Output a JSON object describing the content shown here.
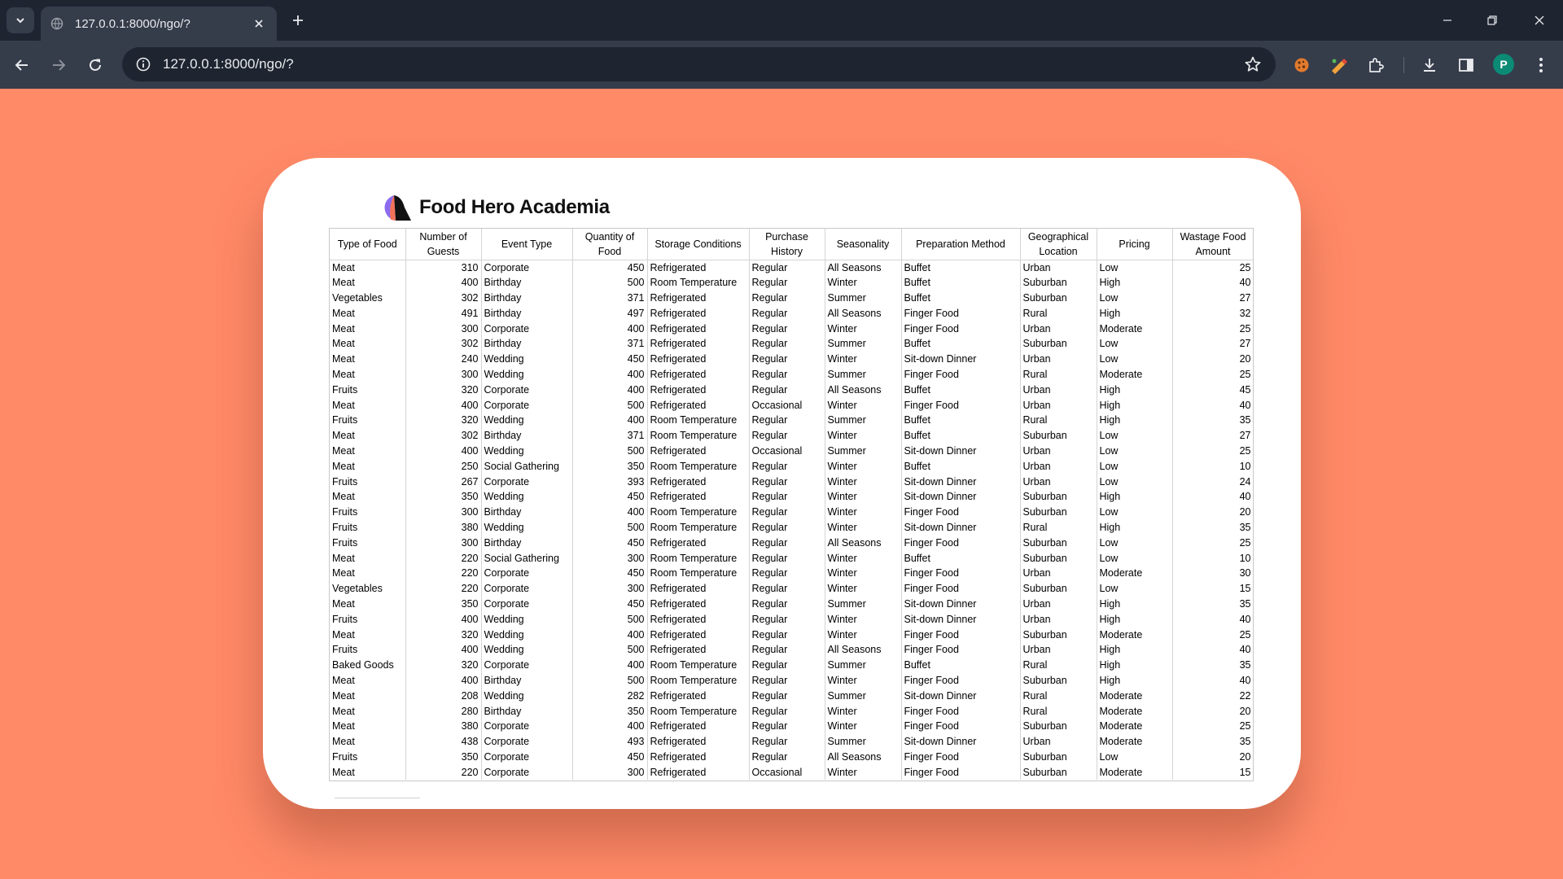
{
  "browser": {
    "tab_title": "127.0.0.1:8000/ngo/?",
    "url": "127.0.0.1:8000/ngo/?",
    "profile_initial": "P"
  },
  "page": {
    "brand_name": "Food Hero Academia",
    "colors": {
      "background": "#ff8a68",
      "card": "#ffffff"
    }
  },
  "table": {
    "headers": [
      "Type of Food",
      "Number of Guests",
      "Event Type",
      "Quantity of Food",
      "Storage Conditions",
      "Purchase History",
      "Seasonality",
      "Preparation Method",
      "Geographical Location",
      "Pricing",
      "Wastage Food Amount"
    ],
    "rows": [
      [
        "Meat",
        "310",
        "Corporate",
        "450",
        "Refrigerated",
        "Regular",
        "All Seasons",
        "Buffet",
        "Urban",
        "Low",
        "25"
      ],
      [
        "Meat",
        "400",
        "Birthday",
        "500",
        "Room Temperature",
        "Regular",
        "Winter",
        "Buffet",
        "Suburban",
        "High",
        "40"
      ],
      [
        "Vegetables",
        "302",
        "Birthday",
        "371",
        "Refrigerated",
        "Regular",
        "Summer",
        "Buffet",
        "Suburban",
        "Low",
        "27"
      ],
      [
        "Meat",
        "491",
        "Birthday",
        "497",
        "Refrigerated",
        "Regular",
        "All Seasons",
        "Finger Food",
        "Rural",
        "High",
        "32"
      ],
      [
        "Meat",
        "300",
        "Corporate",
        "400",
        "Refrigerated",
        "Regular",
        "Winter",
        "Finger Food",
        "Urban",
        "Moderate",
        "25"
      ],
      [
        "Meat",
        "302",
        "Birthday",
        "371",
        "Refrigerated",
        "Regular",
        "Summer",
        "Buffet",
        "Suburban",
        "Low",
        "27"
      ],
      [
        "Meat",
        "240",
        "Wedding",
        "450",
        "Refrigerated",
        "Regular",
        "Winter",
        "Sit-down Dinner",
        "Urban",
        "Low",
        "20"
      ],
      [
        "Meat",
        "300",
        "Wedding",
        "400",
        "Refrigerated",
        "Regular",
        "Summer",
        "Finger Food",
        "Rural",
        "Moderate",
        "25"
      ],
      [
        "Fruits",
        "320",
        "Corporate",
        "400",
        "Refrigerated",
        "Regular",
        "All Seasons",
        "Buffet",
        "Urban",
        "High",
        "45"
      ],
      [
        "Meat",
        "400",
        "Corporate",
        "500",
        "Refrigerated",
        "Occasional",
        "Winter",
        "Finger Food",
        "Urban",
        "High",
        "40"
      ],
      [
        "Fruits",
        "320",
        "Wedding",
        "400",
        "Room Temperature",
        "Regular",
        "Summer",
        "Buffet",
        "Rural",
        "High",
        "35"
      ],
      [
        "Meat",
        "302",
        "Birthday",
        "371",
        "Room Temperature",
        "Regular",
        "Winter",
        "Buffet",
        "Suburban",
        "Low",
        "27"
      ],
      [
        "Meat",
        "400",
        "Wedding",
        "500",
        "Refrigerated",
        "Occasional",
        "Summer",
        "Sit-down Dinner",
        "Urban",
        "Low",
        "25"
      ],
      [
        "Meat",
        "250",
        "Social Gathering",
        "350",
        "Room Temperature",
        "Regular",
        "Winter",
        "Buffet",
        "Urban",
        "Low",
        "10"
      ],
      [
        "Fruits",
        "267",
        "Corporate",
        "393",
        "Refrigerated",
        "Regular",
        "Winter",
        "Sit-down Dinner",
        "Urban",
        "Low",
        "24"
      ],
      [
        "Meat",
        "350",
        "Wedding",
        "450",
        "Refrigerated",
        "Regular",
        "Winter",
        "Sit-down Dinner",
        "Suburban",
        "High",
        "40"
      ],
      [
        "Fruits",
        "300",
        "Birthday",
        "400",
        "Room Temperature",
        "Regular",
        "Winter",
        "Finger Food",
        "Suburban",
        "Low",
        "20"
      ],
      [
        "Fruits",
        "380",
        "Wedding",
        "500",
        "Room Temperature",
        "Regular",
        "Winter",
        "Sit-down Dinner",
        "Rural",
        "High",
        "35"
      ],
      [
        "Fruits",
        "300",
        "Birthday",
        "450",
        "Refrigerated",
        "Regular",
        "All Seasons",
        "Finger Food",
        "Suburban",
        "Low",
        "25"
      ],
      [
        "Meat",
        "220",
        "Social Gathering",
        "300",
        "Room Temperature",
        "Regular",
        "Winter",
        "Buffet",
        "Suburban",
        "Low",
        "10"
      ],
      [
        "Meat",
        "220",
        "Corporate",
        "450",
        "Room Temperature",
        "Regular",
        "Winter",
        "Finger Food",
        "Urban",
        "Moderate",
        "30"
      ],
      [
        "Vegetables",
        "220",
        "Corporate",
        "300",
        "Refrigerated",
        "Regular",
        "Winter",
        "Finger Food",
        "Suburban",
        "Low",
        "15"
      ],
      [
        "Meat",
        "350",
        "Corporate",
        "450",
        "Refrigerated",
        "Regular",
        "Summer",
        "Sit-down Dinner",
        "Urban",
        "High",
        "35"
      ],
      [
        "Fruits",
        "400",
        "Wedding",
        "500",
        "Refrigerated",
        "Regular",
        "Winter",
        "Sit-down Dinner",
        "Urban",
        "High",
        "40"
      ],
      [
        "Meat",
        "320",
        "Wedding",
        "400",
        "Refrigerated",
        "Regular",
        "Winter",
        "Finger Food",
        "Suburban",
        "Moderate",
        "25"
      ],
      [
        "Fruits",
        "400",
        "Wedding",
        "500",
        "Refrigerated",
        "Regular",
        "All Seasons",
        "Finger Food",
        "Urban",
        "High",
        "40"
      ],
      [
        "Baked Goods",
        "320",
        "Corporate",
        "400",
        "Room Temperature",
        "Regular",
        "Summer",
        "Buffet",
        "Rural",
        "High",
        "35"
      ],
      [
        "Meat",
        "400",
        "Birthday",
        "500",
        "Room Temperature",
        "Regular",
        "Winter",
        "Finger Food",
        "Suburban",
        "High",
        "40"
      ],
      [
        "Meat",
        "208",
        "Wedding",
        "282",
        "Refrigerated",
        "Regular",
        "Summer",
        "Sit-down Dinner",
        "Rural",
        "Moderate",
        "22"
      ],
      [
        "Meat",
        "280",
        "Birthday",
        "350",
        "Room Temperature",
        "Regular",
        "Winter",
        "Finger Food",
        "Rural",
        "Moderate",
        "20"
      ],
      [
        "Meat",
        "380",
        "Corporate",
        "400",
        "Refrigerated",
        "Regular",
        "Winter",
        "Finger Food",
        "Suburban",
        "Moderate",
        "25"
      ],
      [
        "Meat",
        "438",
        "Corporate",
        "493",
        "Refrigerated",
        "Regular",
        "Summer",
        "Sit-down Dinner",
        "Urban",
        "Moderate",
        "35"
      ],
      [
        "Fruits",
        "350",
        "Corporate",
        "450",
        "Refrigerated",
        "Regular",
        "All Seasons",
        "Finger Food",
        "Suburban",
        "Low",
        "20"
      ],
      [
        "Meat",
        "220",
        "Corporate",
        "300",
        "Refrigerated",
        "Occasional",
        "Winter",
        "Finger Food",
        "Suburban",
        "Moderate",
        "15"
      ]
    ]
  }
}
